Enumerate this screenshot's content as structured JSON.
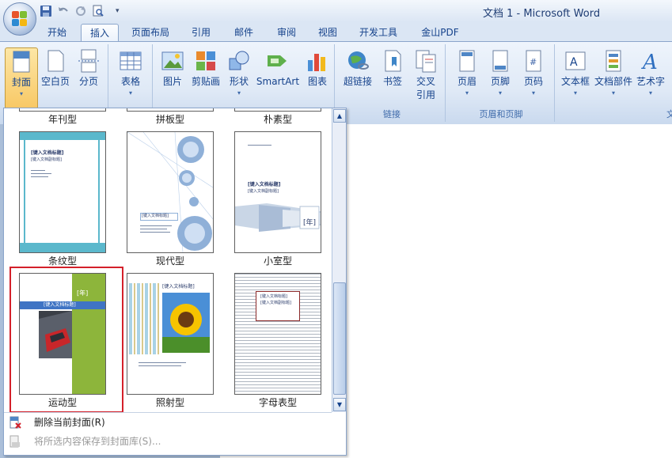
{
  "window": {
    "title": "文档 1 - Microsoft Word"
  },
  "tabs": [
    {
      "label": "开始",
      "active": false
    },
    {
      "label": "插入",
      "active": true
    },
    {
      "label": "页面布局",
      "active": false
    },
    {
      "label": "引用",
      "active": false
    },
    {
      "label": "邮件",
      "active": false
    },
    {
      "label": "审阅",
      "active": false
    },
    {
      "label": "视图",
      "active": false
    },
    {
      "label": "开发工具",
      "active": false
    },
    {
      "label": "金山PDF",
      "active": false
    }
  ],
  "ribbon": {
    "pages": {
      "cover": "封面",
      "blank": "空白页",
      "break": "分页"
    },
    "tables": {
      "table": "表格"
    },
    "illustrations": {
      "picture": "图片",
      "clipart": "剪贴画",
      "shapes": "形状",
      "smartart": "SmartArt",
      "chart": "图表"
    },
    "links": {
      "hyperlink": "超链接",
      "bookmark": "书签",
      "cross_ref_1": "交叉",
      "cross_ref_2": "引用",
      "group": "链接"
    },
    "header_footer": {
      "header": "页眉",
      "footer": "页脚",
      "page_number": "页码",
      "group": "页眉和页脚"
    },
    "text": {
      "textbox": "文本框",
      "quickparts": "文档部件",
      "wordart": "艺术字",
      "group": "文本"
    }
  },
  "gallery": {
    "row0_labels": [
      "年刊型",
      "拼板型",
      "朴素型"
    ],
    "row1_labels": [
      "条纹型",
      "现代型",
      "小室型"
    ],
    "row2_labels": [
      "运动型",
      "照射型",
      "字母表型"
    ],
    "selected": "运动型",
    "preview": {
      "doc_title": "[键入文档标题]",
      "doc_subtitle": "[键入文档副标题]",
      "year": "[年]"
    },
    "menu": {
      "remove": "删除当前封面(R)",
      "save": "将所选内容保存到封面库(S)..."
    }
  },
  "colors": {
    "selection_border": "#d4202a",
    "ribbon_text": "#15428b",
    "stripe_teal": "#5bb8cc",
    "sports_green": "#8db53b",
    "modern_blue": "#8fb0d8"
  }
}
